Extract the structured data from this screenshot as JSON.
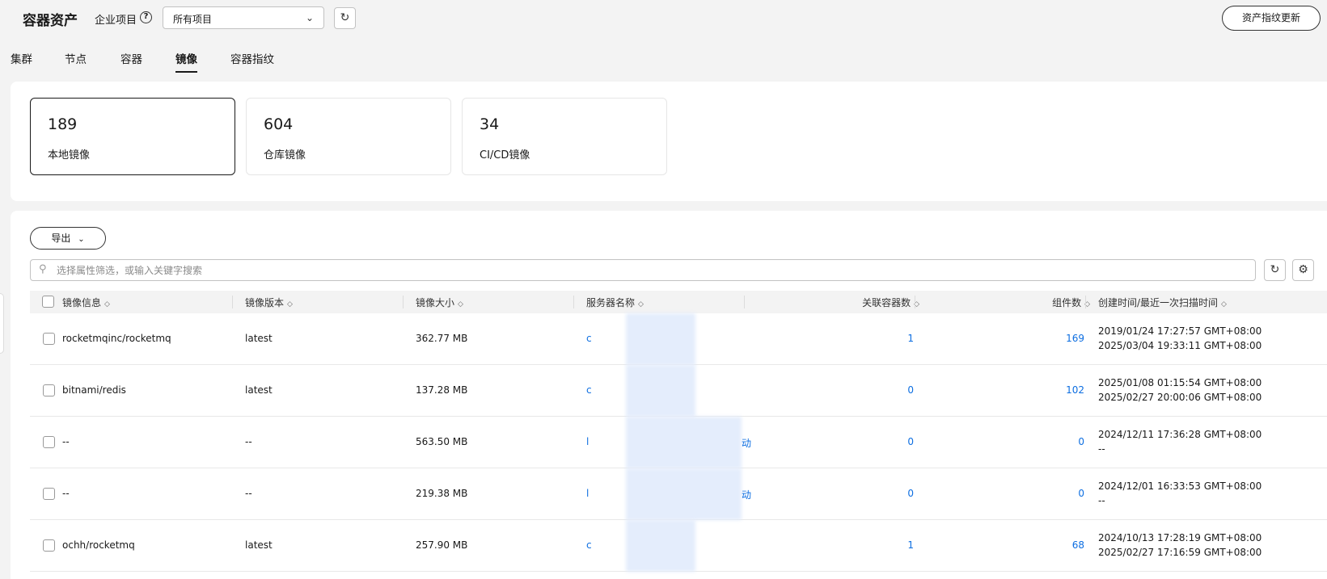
{
  "header": {
    "title": "容器资产",
    "project_label": "企业项目",
    "project_selected": "所有项目",
    "update_button": "资产指纹更新"
  },
  "tabs": [
    {
      "label": "集群",
      "active": false
    },
    {
      "label": "节点",
      "active": false
    },
    {
      "label": "容器",
      "active": false
    },
    {
      "label": "镜像",
      "active": true
    },
    {
      "label": "容器指纹",
      "active": false
    }
  ],
  "summary": [
    {
      "count": "189",
      "label": "本地镜像",
      "active": true
    },
    {
      "count": "604",
      "label": "仓库镜像",
      "active": false
    },
    {
      "count": "34",
      "label": "CI/CD镜像",
      "active": false
    }
  ],
  "toolbar": {
    "export_label": "导出",
    "search_placeholder": "选择属性筛选，或输入关键字搜索"
  },
  "table": {
    "columns": [
      "镜像信息",
      "镜像版本",
      "镜像大小",
      "服务器名称",
      "关联容器数",
      "组件数",
      "创建时间/最近一次扫描时间"
    ],
    "rows": [
      {
        "name": "rocketmqinc/rocketmq",
        "version": "latest",
        "size": "362.77 MB",
        "server": "c",
        "containers": "1",
        "components": "169",
        "created": "2019/01/24 17:27:57 GMT+08:00",
        "scanned": "2025/03/04 19:33:11 GMT+08:00"
      },
      {
        "name": "bitnami/redis",
        "version": "latest",
        "size": "137.28 MB",
        "server": "c",
        "containers": "0",
        "components": "102",
        "created": "2025/01/08 01:15:54 GMT+08:00",
        "scanned": "2025/02/27 20:00:06 GMT+08:00"
      },
      {
        "name": "--",
        "version": "--",
        "size": "563.50 MB",
        "server": "l",
        "server_tail": "动",
        "containers": "0",
        "components": "0",
        "created": "2024/12/11 17:36:28 GMT+08:00",
        "scanned": "--"
      },
      {
        "name": "--",
        "version": "--",
        "size": "219.38 MB",
        "server": "l",
        "server_tail": "动",
        "containers": "0",
        "components": "0",
        "created": "2024/12/01 16:33:53 GMT+08:00",
        "scanned": "--"
      },
      {
        "name": "ochh/rocketmq",
        "version": "latest",
        "size": "257.90 MB",
        "server": "c",
        "containers": "1",
        "components": "68",
        "created": "2024/10/13 17:28:19 GMT+08:00",
        "scanned": "2025/02/27 17:16:59 GMT+08:00"
      }
    ]
  },
  "colors": {
    "link": "#0d6ee1",
    "text": "#191919",
    "page_bg": "#f3f3f3"
  }
}
